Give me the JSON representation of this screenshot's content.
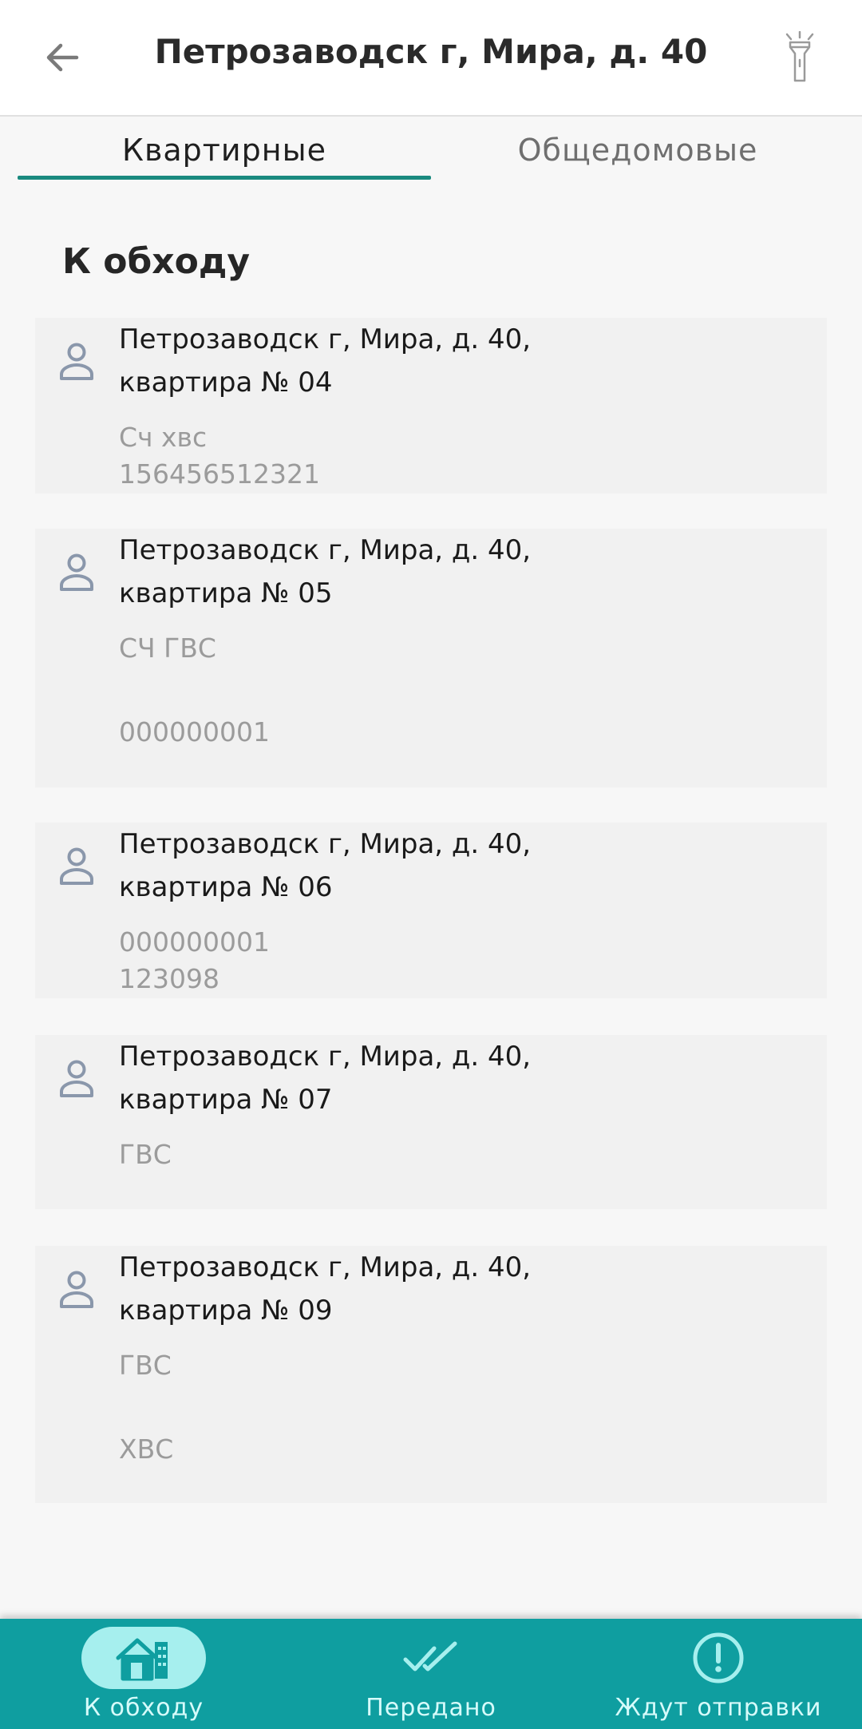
{
  "header": {
    "title": "Петрозаводск г, Мира, д. 40",
    "back_icon": "arrow-left-icon",
    "flashlight_icon": "flashlight-icon"
  },
  "tabs": [
    {
      "label": "Квартирные",
      "active": true
    },
    {
      "label": "Общедомовые",
      "active": false
    }
  ],
  "section": {
    "title": "К обходу"
  },
  "cards": [
    {
      "address_line1": "Петрозаводск г, Мира, д. 40,",
      "address_line2": "квартира № 04",
      "meters": [
        "Сч хвс",
        "156456512321"
      ]
    },
    {
      "address_line1": "Петрозаводск г, Мира, д. 40,",
      "address_line2": "квартира № 05",
      "meters": [
        "СЧ ГВС",
        "000000001"
      ]
    },
    {
      "address_line1": "Петрозаводск г, Мира, д. 40,",
      "address_line2": "квартира № 06",
      "meters": [
        "000000001",
        "123098"
      ]
    },
    {
      "address_line1": "Петрозаводск г, Мира, д. 40,",
      "address_line2": "квартира № 07",
      "meters": [
        "ГВС"
      ]
    },
    {
      "address_line1": "Петрозаводск г, Мира, д. 40,",
      "address_line2": "квартира № 09",
      "meters": [
        "ГВС",
        "ХВС"
      ]
    }
  ],
  "bottom_nav": [
    {
      "label": "К обходу",
      "icon": "house-icon",
      "active": true
    },
    {
      "label": "Передано",
      "icon": "double-check-icon",
      "active": false
    },
    {
      "label": "Ждут отправки",
      "icon": "exclamation-circle-icon",
      "active": false
    }
  ],
  "colors": {
    "accent": "#1a8a7f",
    "bottom_nav_bg": "#0f9ea0",
    "active_pill": "#a6efee"
  }
}
